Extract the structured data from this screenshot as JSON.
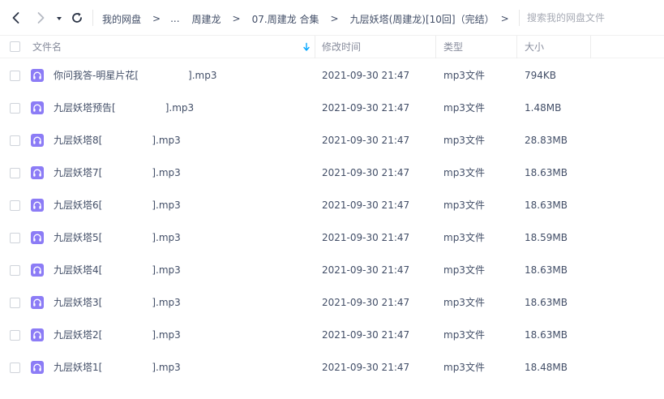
{
  "nav": {
    "back_icon": "chevron-left-icon",
    "forward_icon": "chevron-right-icon",
    "history_icon": "caret-down-icon",
    "refresh_icon": "refresh-icon"
  },
  "breadcrumbs": [
    "我的网盘",
    "...",
    "周建龙",
    "07.周建龙 合集",
    "九层妖塔(周建龙)[10回]（完结）"
  ],
  "breadcrumb_separator": ">",
  "search": {
    "placeholder": "搜索我的网盘文件"
  },
  "columns": {
    "name": "文件名",
    "modified": "修改时间",
    "type": "类型",
    "size": "大小"
  },
  "sort": {
    "icon": "sort-down-arrow-icon",
    "color": "#06a7ff"
  },
  "files": [
    {
      "name": "你问我答-明星片花[                ].mp3",
      "modified": "2021-09-30 21:47",
      "type": "mp3文件",
      "size": "794KB"
    },
    {
      "name": "九层妖塔预告[                ].mp3",
      "modified": "2021-09-30 21:47",
      "type": "mp3文件",
      "size": "1.48MB"
    },
    {
      "name": "九层妖塔8[                ].mp3",
      "modified": "2021-09-30 21:47",
      "type": "mp3文件",
      "size": "28.83MB"
    },
    {
      "name": "九层妖塔7[                ].mp3",
      "modified": "2021-09-30 21:47",
      "type": "mp3文件",
      "size": "18.63MB"
    },
    {
      "name": "九层妖塔6[                ].mp3",
      "modified": "2021-09-30 21:47",
      "type": "mp3文件",
      "size": "18.63MB"
    },
    {
      "name": "九层妖塔5[                ].mp3",
      "modified": "2021-09-30 21:47",
      "type": "mp3文件",
      "size": "18.59MB"
    },
    {
      "name": "九层妖塔4[                ].mp3",
      "modified": "2021-09-30 21:47",
      "type": "mp3文件",
      "size": "18.63MB"
    },
    {
      "name": "九层妖塔3[                ].mp3",
      "modified": "2021-09-30 21:47",
      "type": "mp3文件",
      "size": "18.63MB"
    },
    {
      "name": "九层妖塔2[                ].mp3",
      "modified": "2021-09-30 21:47",
      "type": "mp3文件",
      "size": "18.63MB"
    },
    {
      "name": "九层妖塔1[                ].mp3",
      "modified": "2021-09-30 21:47",
      "type": "mp3文件",
      "size": "18.48MB"
    }
  ],
  "file_icon": "audio-file-headphones-icon",
  "colors": {
    "audio_icon": "#8c7cf6",
    "text": "#424e67",
    "header_text": "#878c9c",
    "placeholder": "#a7abb5"
  }
}
